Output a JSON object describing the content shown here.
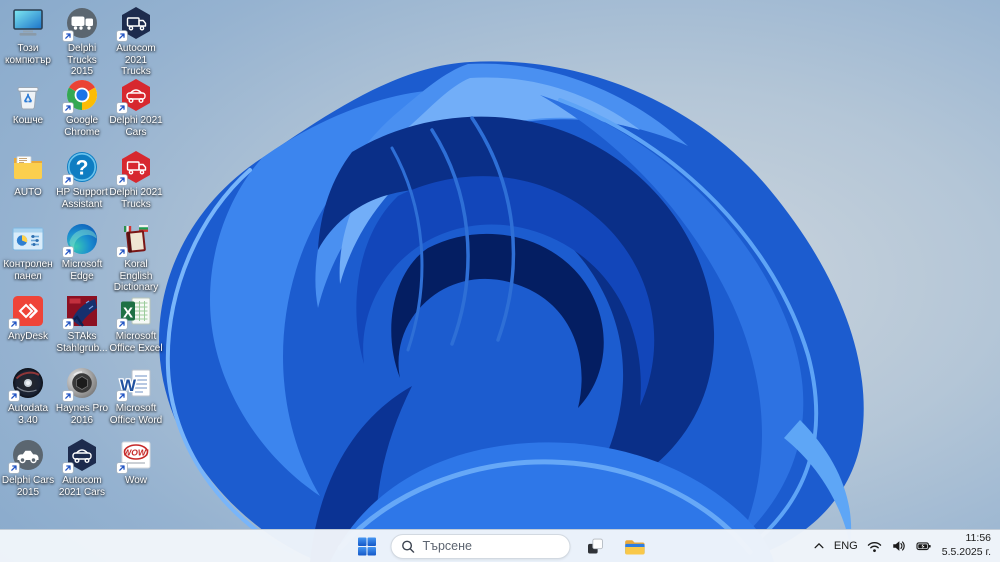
{
  "desktop": {
    "icons": [
      {
        "label": "Този компютър",
        "glyph": "this-pc",
        "shortcut": false
      },
      {
        "label": "Delphi Trucks 2015",
        "glyph": "trucks-circle",
        "shortcut": true
      },
      {
        "label": "Autocom 2021 Trucks",
        "glyph": "truck-hex-dark",
        "shortcut": true
      },
      {
        "label": "Кошче",
        "glyph": "recycle-bin",
        "shortcut": false
      },
      {
        "label": "Google Chrome",
        "glyph": "chrome",
        "shortcut": true
      },
      {
        "label": "Delphi 2021 Cars",
        "glyph": "car-hex-red",
        "shortcut": true
      },
      {
        "label": "AUTO",
        "glyph": "folder",
        "shortcut": false
      },
      {
        "label": "HP Support Assistant",
        "glyph": "hp-question",
        "shortcut": true
      },
      {
        "label": "Delphi 2021 Trucks",
        "glyph": "truck-hex-red",
        "shortcut": true
      },
      {
        "label": "Контролен панел",
        "glyph": "control-panel",
        "shortcut": false
      },
      {
        "label": "Microsoft Edge",
        "glyph": "edge",
        "shortcut": true
      },
      {
        "label": "Koral English Dictionary",
        "glyph": "dictionary",
        "shortcut": true
      },
      {
        "label": "AnyDesk",
        "glyph": "anydesk",
        "shortcut": true
      },
      {
        "label": "STAks Stahlgrub...",
        "glyph": "stahl",
        "shortcut": true
      },
      {
        "label": "Microsoft Office Excel",
        "glyph": "excel",
        "shortcut": true
      },
      {
        "label": "Autodata 3.40",
        "glyph": "disc",
        "shortcut": true
      },
      {
        "label": "Haynes Pro 2016",
        "glyph": "haynes",
        "shortcut": true
      },
      {
        "label": "Microsoft Office Word",
        "glyph": "word",
        "shortcut": true
      },
      {
        "label": "Delphi Cars 2015",
        "glyph": "cars-circle",
        "shortcut": true
      },
      {
        "label": "Autocom 2021 Cars",
        "glyph": "car-hex-dark",
        "shortcut": true
      },
      {
        "label": "Wow",
        "glyph": "wow",
        "shortcut": true
      }
    ]
  },
  "taskbar": {
    "search": {
      "placeholder": "Търсене"
    },
    "tray": {
      "language": "ENG",
      "time": "11:56",
      "date": "5.5.2025 г."
    }
  },
  "colors": {
    "bloom_primary": "#1c5ccf",
    "bloom_dark": "#0a2f88",
    "bg_edge": "#84a7ca",
    "bg_light": "#ccd5dd",
    "taskbar_bg": "#f1f5fa"
  }
}
